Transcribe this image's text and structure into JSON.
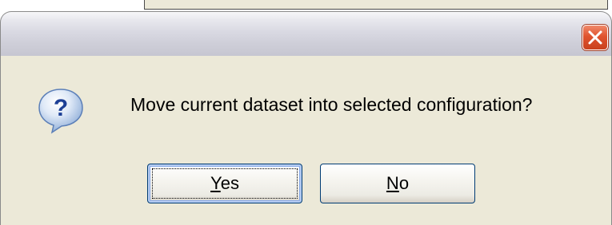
{
  "dialog": {
    "title": "",
    "message": "Move current dataset into selected configuration?",
    "icon": "question-icon",
    "close_icon": "close-icon",
    "buttons": {
      "yes": {
        "mnemonic": "Y",
        "rest": "es"
      },
      "no": {
        "mnemonic": "N",
        "rest": "o"
      }
    }
  },
  "colors": {
    "dialog_body": "#ece9d8",
    "close_button": "#e0532e",
    "button_border": "#003c74"
  }
}
